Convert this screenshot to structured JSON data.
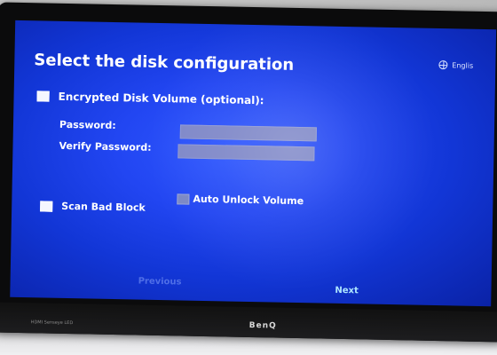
{
  "installer": {
    "title": "Select the disk configuration",
    "language": "Englis",
    "encrypted_volume_label": "Encrypted Disk Volume (optional):",
    "password_label": "Password:",
    "verify_password_label": "Verify Password:",
    "password_value": "",
    "verify_password_value": "",
    "auto_unlock_label": "Auto Unlock Volume",
    "scan_bad_block_label": "Scan Bad Block",
    "previous_label": "Previous",
    "next_label": "Next",
    "encrypted_checked": false,
    "auto_unlock_checked": false,
    "auto_unlock_enabled": false,
    "scan_bad_block_checked": false
  },
  "monitor": {
    "brand": "BenQ",
    "model_text": "HDMI Senseye LED"
  },
  "colors": {
    "screen_blue": "#2246f2",
    "text_white": "#ffffff",
    "disabled_field": "#7f88c8",
    "next_cyan": "#aee6ff",
    "previous_blue": "#4f6ee7"
  },
  "icons": {
    "language": "globe-icon"
  }
}
